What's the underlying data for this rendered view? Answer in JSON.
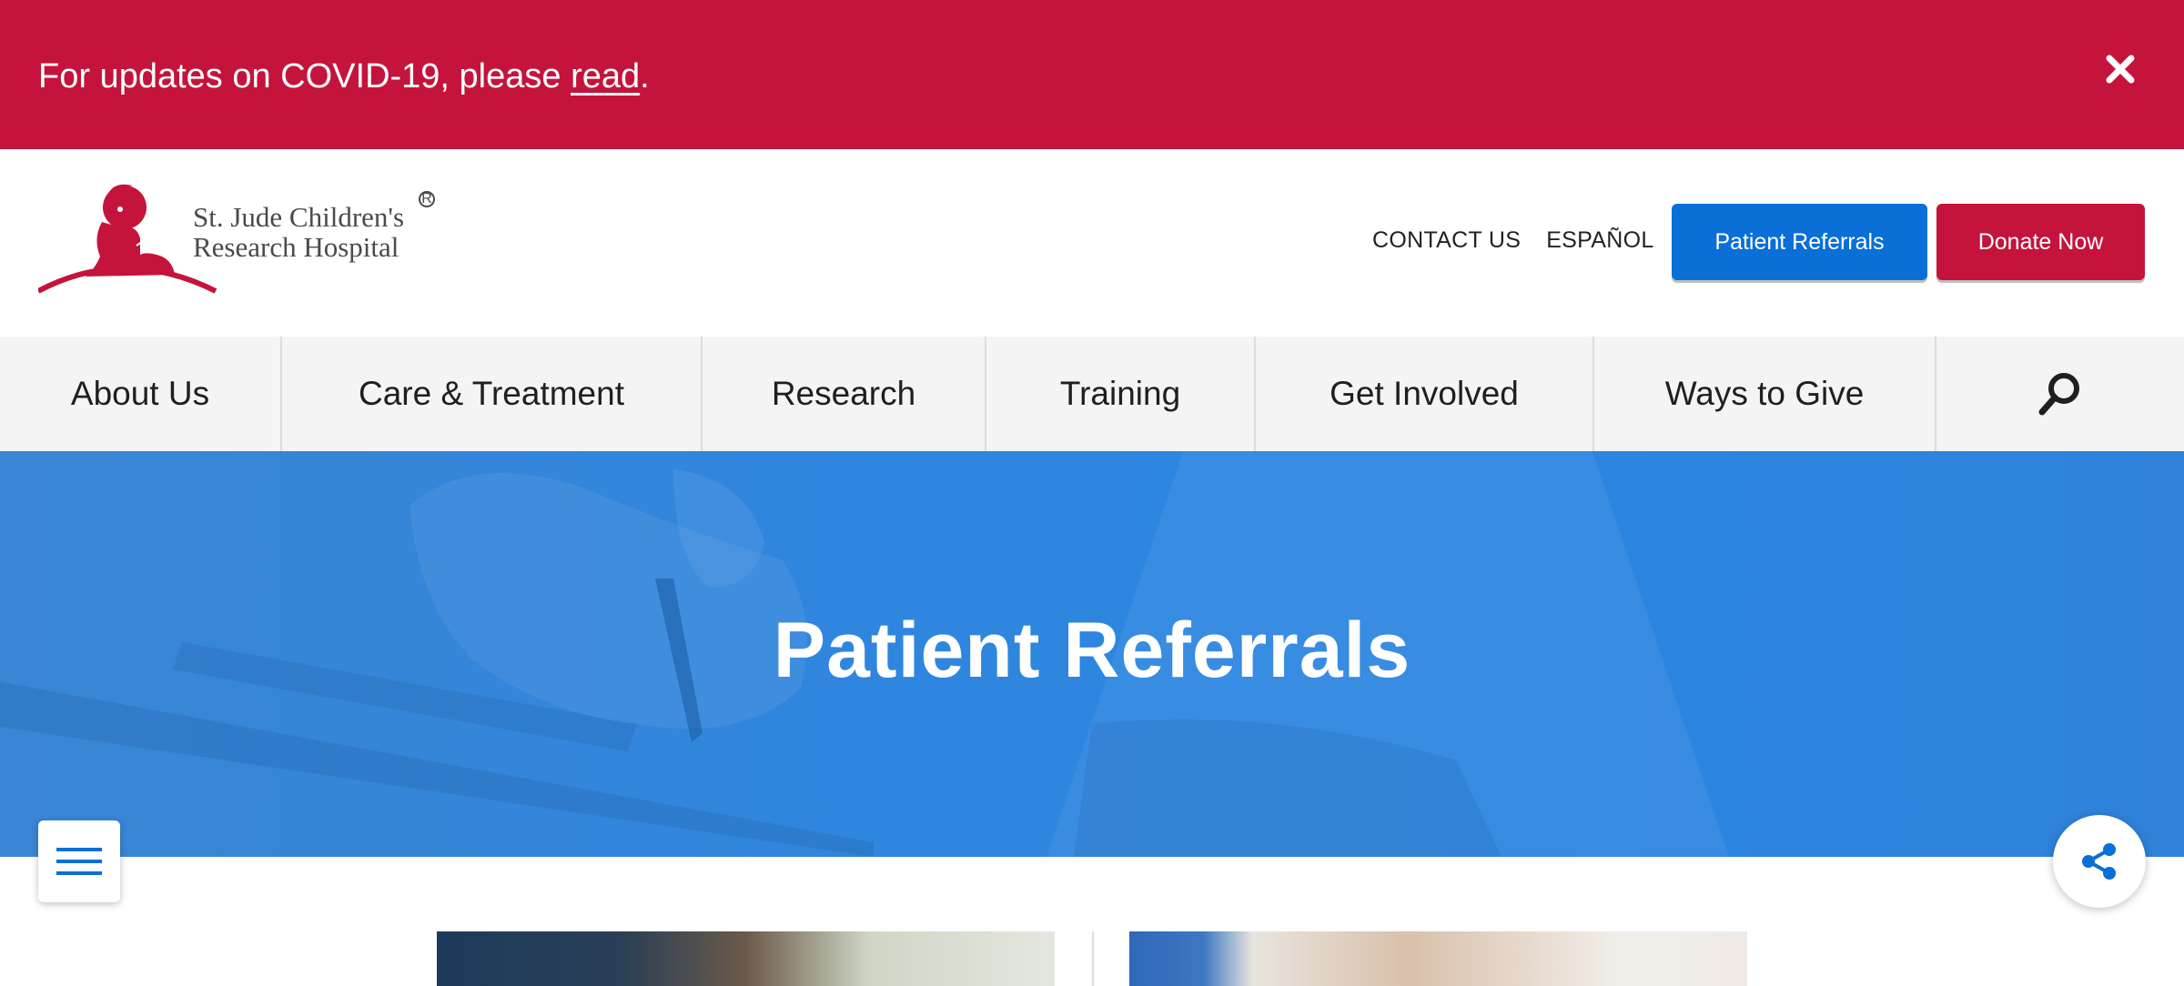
{
  "alert": {
    "text_before": "For updates on COVID-19, please ",
    "link": "read",
    "text_after": "."
  },
  "logo": {
    "line1": "St. Jude Children's",
    "line2": "Research Hospital",
    "reg": "R"
  },
  "header": {
    "contact": "CONTACT US",
    "espanol": "ESPAÑOL",
    "referrals_button": "Patient Referrals",
    "donate_button": "Donate Now"
  },
  "nav": {
    "items": [
      {
        "label": "About Us"
      },
      {
        "label": "Care & Treatment"
      },
      {
        "label": "Research"
      },
      {
        "label": "Training"
      },
      {
        "label": "Get Involved"
      },
      {
        "label": "Ways to Give"
      }
    ],
    "search_icon": "search-icon"
  },
  "hero": {
    "title": "Patient Referrals"
  },
  "colors": {
    "brand_red": "#c4143b",
    "brand_blue": "#0a6fd6",
    "hero_blue": "#2b86e0",
    "nav_bg": "#f4f4f4"
  },
  "icons": {
    "close": "close-icon",
    "menu": "hamburger-menu-icon",
    "share": "share-icon"
  }
}
